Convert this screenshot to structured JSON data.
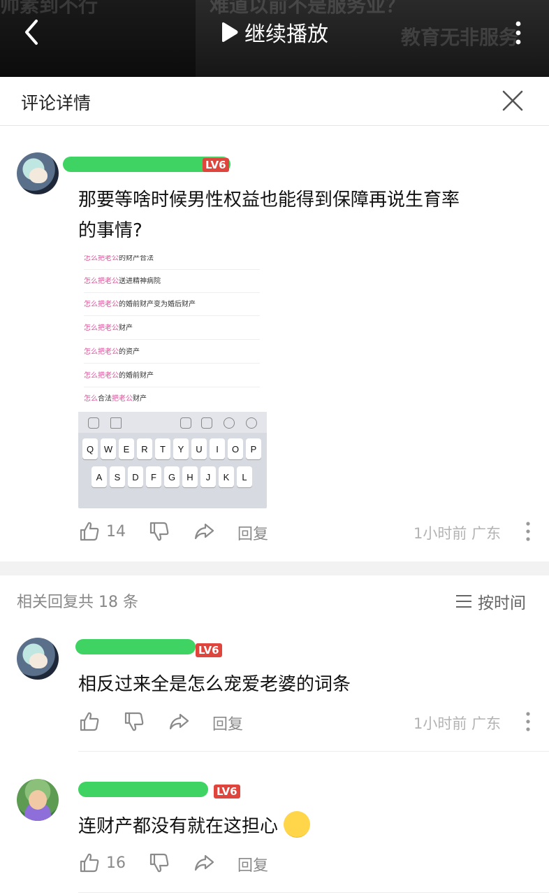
{
  "colors": {
    "accent_green": "#34d15a",
    "level_badge": "#e0453d",
    "muted": "#8a8a8a"
  },
  "video_bar": {
    "ghost_left": "帅素到不行",
    "ghost_center": "难道以前不是服务业？",
    "ghost_right": "教育无非服务",
    "play_label": "继续播放",
    "icons": {
      "back": "chevron-left-icon",
      "play": "play-icon",
      "more": "more-vertical-icon"
    }
  },
  "header": {
    "title": "评论详情",
    "close_icon": "close-icon"
  },
  "main_comment": {
    "level": "LV6",
    "text_line1": "那要等啥时候男性权益也能得到保障再说生育率",
    "text_line2": "的事情?",
    "image": {
      "suggestions": [
        {
          "pink": "怎么把老公",
          "rest": "的财产合法"
        },
        {
          "pink": "怎么把老公",
          "rest": "送进精神病院"
        },
        {
          "pink": "怎么把老公",
          "rest": "的婚前财产变为婚后财产"
        },
        {
          "pink": "怎么把老公",
          "rest": "财产"
        },
        {
          "pink": "怎么把老公",
          "rest": "的资产"
        },
        {
          "pink": "怎么把老公",
          "rest": "的婚前财产"
        },
        {
          "pink": "怎么",
          "rest": "合法",
          "pink2": "把老公",
          "rest2": "财产"
        }
      ],
      "keys_row1": [
        "Q",
        "W",
        "E",
        "R",
        "T",
        "Y",
        "U",
        "I",
        "O",
        "P"
      ],
      "keys_row2": [
        "A",
        "S",
        "D",
        "F",
        "G",
        "H",
        "J",
        "K",
        "L"
      ]
    },
    "likes": "14",
    "reply_label": "回复",
    "meta": "1小时前 广东"
  },
  "replies_header": {
    "count_label": "相关回复共 18 条",
    "sort_label": "按时间"
  },
  "replies": [
    {
      "level": "LV6",
      "text": "相反过来全是怎么宠爱老婆的词条",
      "likes": "",
      "reply_label": "回复",
      "meta": "1小时前 广东"
    },
    {
      "level": "LV6",
      "text": "连财产都没有就在这担心",
      "likes": "16",
      "reply_label": "回复",
      "meta": ""
    }
  ]
}
